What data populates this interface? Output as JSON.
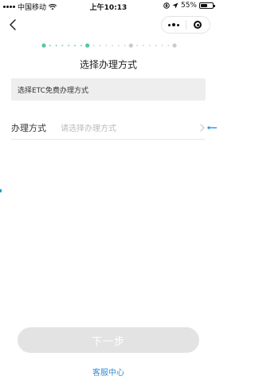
{
  "status_bar": {
    "carrier": "中国移动",
    "time": "上午10:13",
    "battery_percent_text": "55%",
    "battery_level": 0.55
  },
  "nav": {
    "back_icon": "chevron-left-icon",
    "menu_icon": "more-dots-icon",
    "close_icon": "target-close-icon"
  },
  "progress": {
    "total_steps": 4,
    "completed_steps": 2,
    "active_color": "#5cc4a2",
    "inactive_color": "#cccccc"
  },
  "page": {
    "title": "选择办理方式"
  },
  "banner": {
    "text": "选择ETC免费办理方式"
  },
  "form": {
    "label": "办理方式",
    "placeholder": "请选择办理方式"
  },
  "actions": {
    "next_label": "下一步",
    "service_label": "客服中心"
  },
  "colors": {
    "accent": "#3a8cd6",
    "step_active": "#5cc4a2",
    "button_disabled": "#e3e3e3"
  }
}
